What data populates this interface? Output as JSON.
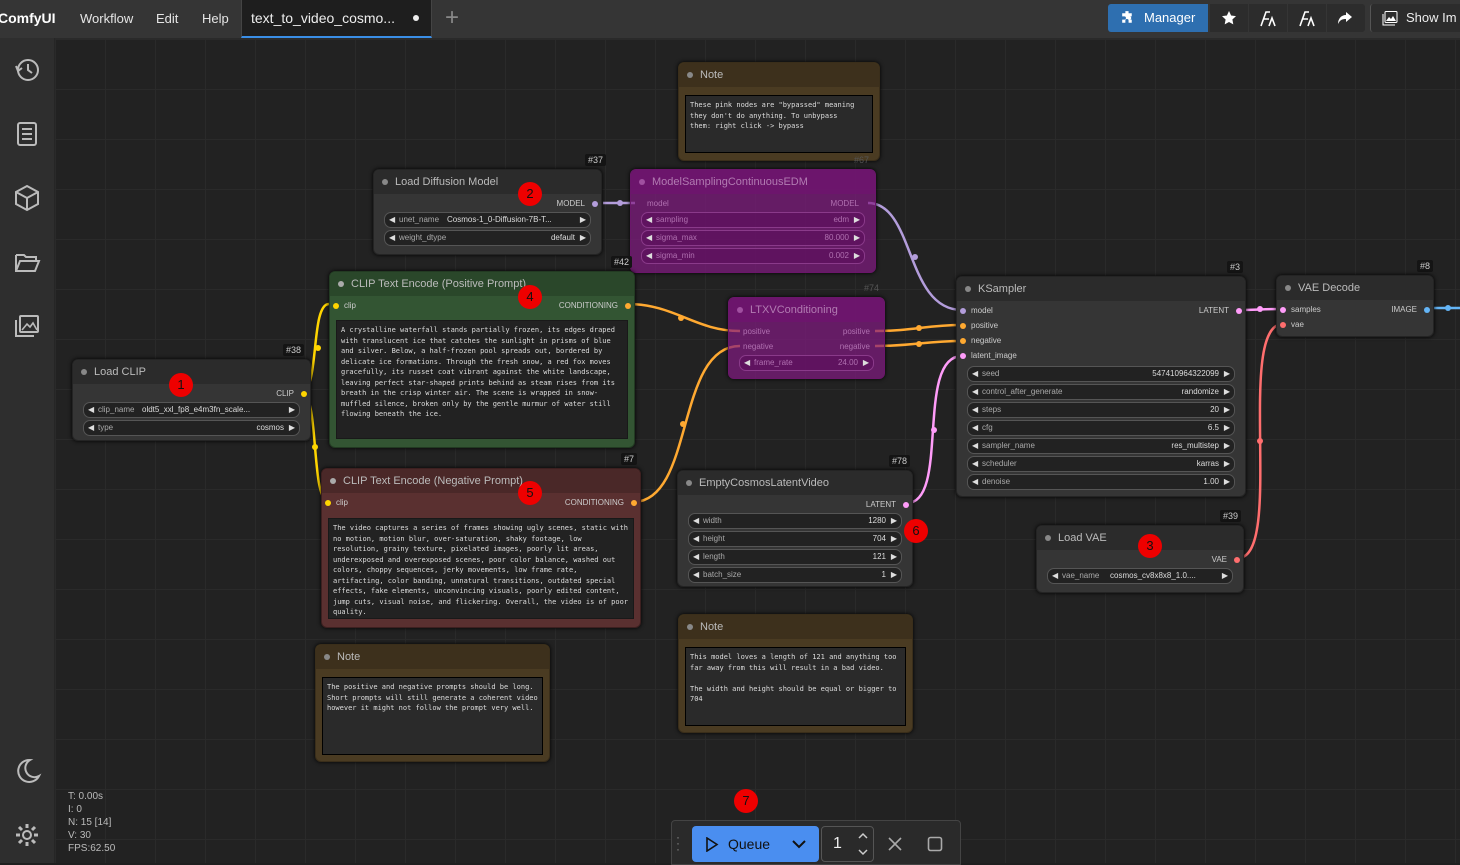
{
  "menubar": {
    "brand": "ComfyUI",
    "items": [
      "Workflow",
      "Edit",
      "Help"
    ],
    "tab_title": "text_to_video_cosmo...",
    "right": {
      "manager": "Manager",
      "show_image": "Show Im"
    }
  },
  "nodes": {
    "load_clip": {
      "id": "#38",
      "title": "Load CLIP",
      "output": "CLIP",
      "widgets": [
        {
          "name": "clip_name",
          "value": "oldt5_xxl_fp8_e4m3fn_scale..."
        },
        {
          "name": "type",
          "value": "cosmos"
        }
      ]
    },
    "load_diffusion": {
      "id": "#37",
      "title": "Load Diffusion Model",
      "output": "MODEL",
      "widgets": [
        {
          "name": "unet_name",
          "value": "Cosmos-1_0-Diffusion-7B-T..."
        },
        {
          "name": "weight_dtype",
          "value": "default"
        }
      ]
    },
    "model_sampling": {
      "id": "#67",
      "title": "ModelSamplingContinuousEDM",
      "input": "model",
      "output": "MODEL",
      "widgets": [
        {
          "name": "sampling",
          "value": "edm"
        },
        {
          "name": "sigma_max",
          "value": "80.000"
        },
        {
          "name": "sigma_min",
          "value": "0.002"
        }
      ]
    },
    "pos_prompt": {
      "id": "#42",
      "title": "CLIP Text Encode (Positive Prompt)",
      "input": "clip",
      "output": "CONDITIONING",
      "text": "A crystalline waterfall stands partially frozen, its edges draped with translucent ice that catches the sunlight in prisms of blue and silver. Below, a half-frozen pool spreads out, bordered by delicate ice formations. Through the fresh snow, a red fox moves gracefully, its russet coat vibrant against the white landscape, leaving perfect star-shaped prints behind as steam rises from its breath in the crisp winter air. The scene is wrapped in snow-muffled silence, broken only by the gentle murmur of water still flowing beneath the ice."
    },
    "neg_prompt": {
      "id": "#7",
      "title": "CLIP Text Encode (Negative Prompt)",
      "input": "clip",
      "output": "CONDITIONING",
      "text": "The video captures a series of frames showing ugly scenes, static with no motion, motion blur, over-saturation, shaky footage, low resolution, grainy texture, pixelated images, poorly lit areas, underexposed and overexposed scenes, poor color balance, washed out colors, choppy sequences, jerky movements, low frame rate, artifacting, color banding, unnatural transitions, outdated special effects, fake elements, unconvincing visuals, poorly edited content, jump cuts, visual noise, and flickering. Overall, the video is of poor quality."
    },
    "ltxv": {
      "id": "#74",
      "title": "LTXVConditioning",
      "inputs": [
        "positive",
        "negative"
      ],
      "outputs": [
        "positive",
        "negative"
      ],
      "widgets": [
        {
          "name": "frame_rate",
          "value": "24.00"
        }
      ]
    },
    "ksampler": {
      "id": "#3",
      "title": "KSampler",
      "inputs": [
        "model",
        "positive",
        "negative",
        "latent_image"
      ],
      "output": "LATENT",
      "widgets": [
        {
          "name": "seed",
          "value": "547410964322099"
        },
        {
          "name": "control_after_generate",
          "value": "randomize"
        },
        {
          "name": "steps",
          "value": "20"
        },
        {
          "name": "cfg",
          "value": "6.5"
        },
        {
          "name": "sampler_name",
          "value": "res_multistep"
        },
        {
          "name": "scheduler",
          "value": "karras"
        },
        {
          "name": "denoise",
          "value": "1.00"
        }
      ]
    },
    "vae_decode": {
      "id": "#8",
      "title": "VAE Decode",
      "inputs": [
        "samples",
        "vae"
      ],
      "output": "IMAGE"
    },
    "latent_video": {
      "id": "#78",
      "title": "EmptyCosmosLatentVideo",
      "output": "LATENT",
      "widgets": [
        {
          "name": "width",
          "value": "1280"
        },
        {
          "name": "height",
          "value": "704"
        },
        {
          "name": "length",
          "value": "121"
        },
        {
          "name": "batch_size",
          "value": "1"
        }
      ]
    },
    "load_vae": {
      "id": "#39",
      "title": "Load VAE",
      "output": "VAE",
      "widgets": [
        {
          "name": "vae_name",
          "value": "cosmos_cv8x8x8_1.0...."
        }
      ]
    },
    "note_top": {
      "title": "Note",
      "text": "These pink nodes are \"bypassed\" meaning\nthey don't do anything. To unbypass\nthem: right click -> bypass"
    },
    "note_left": {
      "title": "Note",
      "text": "The positive and negative prompts should be long. Short prompts will still generate a coherent video however it might not follow the prompt very well."
    },
    "note_mid": {
      "title": "Note",
      "text": "This model loves a length of 121 and anything too far away from this will result in a bad video.\n\nThe width and height should be equal or bigger to 704"
    }
  },
  "badges": [
    "1",
    "2",
    "3",
    "4",
    "5",
    "6",
    "7"
  ],
  "stats": {
    "t": "T: 0.00s",
    "i": "I: 0",
    "n": "N: 15 [14]",
    "v": "V: 30",
    "fps": "FPS:62.50"
  },
  "queue": {
    "label": "Queue",
    "count": "1"
  },
  "colors": {
    "accent": "#4a8ef0",
    "manager": "#2e6fb0",
    "badge": "#e00000",
    "conditioning": "#ffa931",
    "clip": "#ffd500",
    "model": "#b39ddb",
    "latent": "#ff9cf9",
    "vae": "#ff6e6e",
    "image": "#64b5f6"
  }
}
